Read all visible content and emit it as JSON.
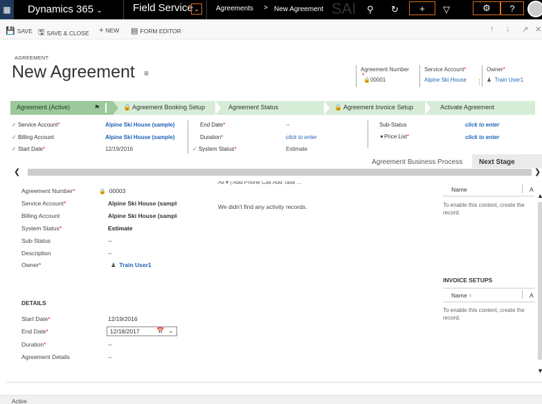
{
  "nav": {
    "app_name": "Dynamics 365",
    "module": "Field Service",
    "crumb_entity": "Agreements",
    "crumb_sep": ">",
    "crumb_record": "New Agreement",
    "ghost_text": "SAI"
  },
  "commands": {
    "save": "SAVE",
    "save_close": "SAVE & CLOSE",
    "new": "NEW",
    "form_editor": "FORM EDITOR"
  },
  "header": {
    "entity_type": "AGREEMENT",
    "title": "New Agreement",
    "fields": [
      {
        "label": "Agreement Number",
        "value": "00001"
      },
      {
        "label": "Service Account",
        "value": "Alpine Ski House"
      },
      {
        "label": "Owner",
        "value": "Train User1"
      }
    ]
  },
  "bpf": {
    "stages": [
      {
        "label": "Agreement (Active)"
      },
      {
        "label": "Agreement Booking Setup"
      },
      {
        "label": "Agreement Status"
      },
      {
        "label": "Agreement Invoice Setup"
      },
      {
        "label": "Activate Agreement"
      }
    ],
    "col1": [
      {
        "label": "Service Account",
        "value": "Alpine Ski House (sample)"
      },
      {
        "label": "Billing Account",
        "value": "Alpine Ski House (sample)"
      },
      {
        "label": "Start Date",
        "value": "12/19/2016"
      }
    ],
    "col2": [
      {
        "label": "End Date",
        "value": "--"
      },
      {
        "label": "Duration",
        "value": "click to enter"
      },
      {
        "label": "System Status",
        "value": "Estimate"
      }
    ],
    "col3": [
      {
        "label": "Sub-Status",
        "value": "click to enter"
      },
      {
        "label": "Price List",
        "value": "click to enter"
      }
    ],
    "footer_process": "Agreement Business Process",
    "footer_next": "Next Stage"
  },
  "general": {
    "rows": [
      {
        "label": "Agreement Number",
        "value": "00003"
      },
      {
        "label": "Service Account",
        "value": "Alpine Ski House (sample)"
      },
      {
        "label": "Billing Account",
        "value": "Alpine Ski House (sample)"
      },
      {
        "label": "System Status",
        "value": "Estimate"
      },
      {
        "label": "Sub-Status",
        "value": "--"
      },
      {
        "label": "Description",
        "value": "--"
      },
      {
        "label": "Owner",
        "value": "Train User1"
      }
    ]
  },
  "details": {
    "title": "DETAILS",
    "start_label": "Start Date",
    "start_value": "12/19/2016",
    "end_label": "End Date",
    "end_value": "12/18/2017",
    "duration_label": "Duration",
    "duration_value": "--",
    "details_label": "Agreement Details",
    "details_value": "--"
  },
  "activities": {
    "toolbar_text": "All  ▾  |  Add Phone Call   Add Task   ...",
    "empty": "We didn't find any activity records."
  },
  "right_grid1": {
    "col": "Name",
    "col2": "A",
    "msg": "To enable this content, create the record."
  },
  "invoice_setups": {
    "title": "INVOICE SETUPS",
    "col": "Name ↑",
    "col2": "A",
    "msg": "To enable this content, create the record."
  },
  "status": {
    "text": "Active"
  }
}
